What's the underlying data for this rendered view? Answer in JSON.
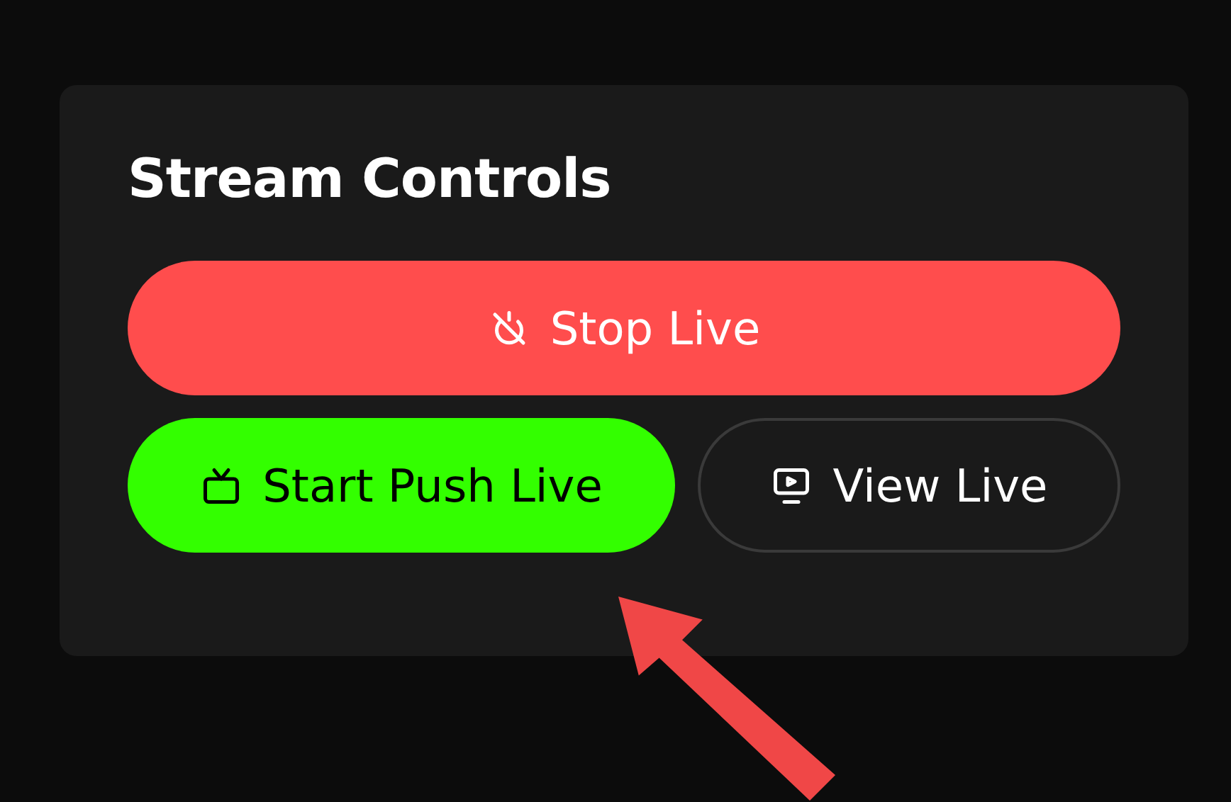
{
  "panel": {
    "title": "Stream Controls"
  },
  "buttons": [
    {
      "label": "Stop Live",
      "kind": "danger"
    },
    {
      "label": "Start Push Live",
      "kind": "primary"
    },
    {
      "label": "View Live",
      "kind": "outline"
    }
  ]
}
